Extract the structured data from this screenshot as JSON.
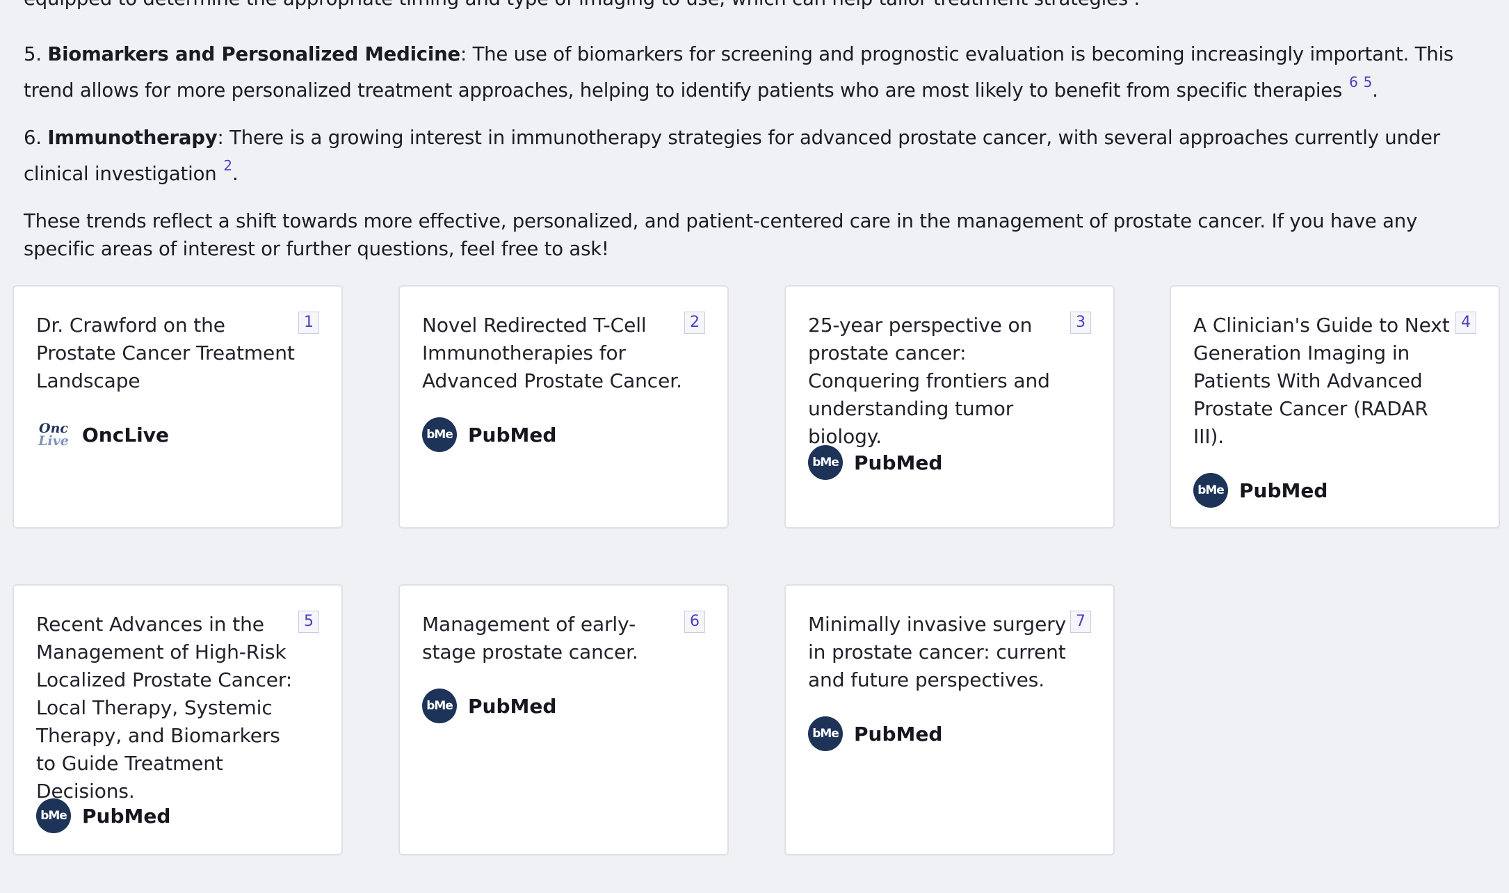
{
  "answer": {
    "top_fragment": "equipped to determine the appropriate timing and type of imaging to use, which can help tailor treatment strategies",
    "top_fragment_end": ".",
    "item5": {
      "number": "5.",
      "heading": "Biomarkers and Personalized Medicine",
      "text": ": The use of biomarkers for screening and prognostic evaluation is becoming increasingly important. This trend allows for more personalized treatment approaches, helping to identify patients who are most likely to benefit from specific therapies",
      "citations": [
        "6",
        "5"
      ],
      "end": "."
    },
    "item6": {
      "number": "6.",
      "heading": "Immunotherapy",
      "text": ": There is a growing interest in immunotherapy strategies for advanced prostate cancer, with several approaches currently under clinical investigation",
      "citations": [
        "2"
      ],
      "end": "."
    },
    "closing": "These trends reflect a shift towards more effective, personalized, and patient-centered care in the management of prostate cancer. If you have any specific areas of interest or further questions, feel free to ask!"
  },
  "sources": [
    {
      "num": "1",
      "title": "Dr. Crawford on the Prostate Cancer Treatment Landscape",
      "site": "OncLive",
      "icon": "onclive-logo-icon",
      "logo_top": "Onc",
      "logo_bottom": "Live"
    },
    {
      "num": "2",
      "title": "Novel Redirected T-Cell Immunotherapies for Advanced Prostate Cancer.",
      "site": "PubMed",
      "icon": "pubmed-logo-icon",
      "logo_text": "bMe"
    },
    {
      "num": "3",
      "title": "25-year perspective on prostate cancer: Conquering frontiers and understanding tumor biology.",
      "site": "PubMed",
      "icon": "pubmed-logo-icon",
      "logo_text": "bMe"
    },
    {
      "num": "4",
      "title": "A Clinician's Guide to Next Generation Imaging in Patients With Advanced Prostate Cancer (RADAR III).",
      "site": "PubMed",
      "icon": "pubmed-logo-icon",
      "logo_text": "bMe"
    },
    {
      "num": "5",
      "title": "Recent Advances in the Management of High-Risk Localized Prostate Cancer: Local Therapy, Systemic Therapy, and Biomarkers to Guide Treatment Decisions.",
      "site": "PubMed",
      "icon": "pubmed-logo-icon",
      "logo_text": "bMe"
    },
    {
      "num": "6",
      "title": "Management of early-stage prostate cancer.",
      "site": "PubMed",
      "icon": "pubmed-logo-icon",
      "logo_text": "bMe"
    },
    {
      "num": "7",
      "title": "Minimally invasive surgery in prostate cancer: current and future perspectives.",
      "site": "PubMed",
      "icon": "pubmed-logo-icon",
      "logo_text": "bMe"
    }
  ],
  "colors": {
    "background": "#eff1f5",
    "citation": "#4a3fc0",
    "pubmed_logo": "#1d3358"
  }
}
